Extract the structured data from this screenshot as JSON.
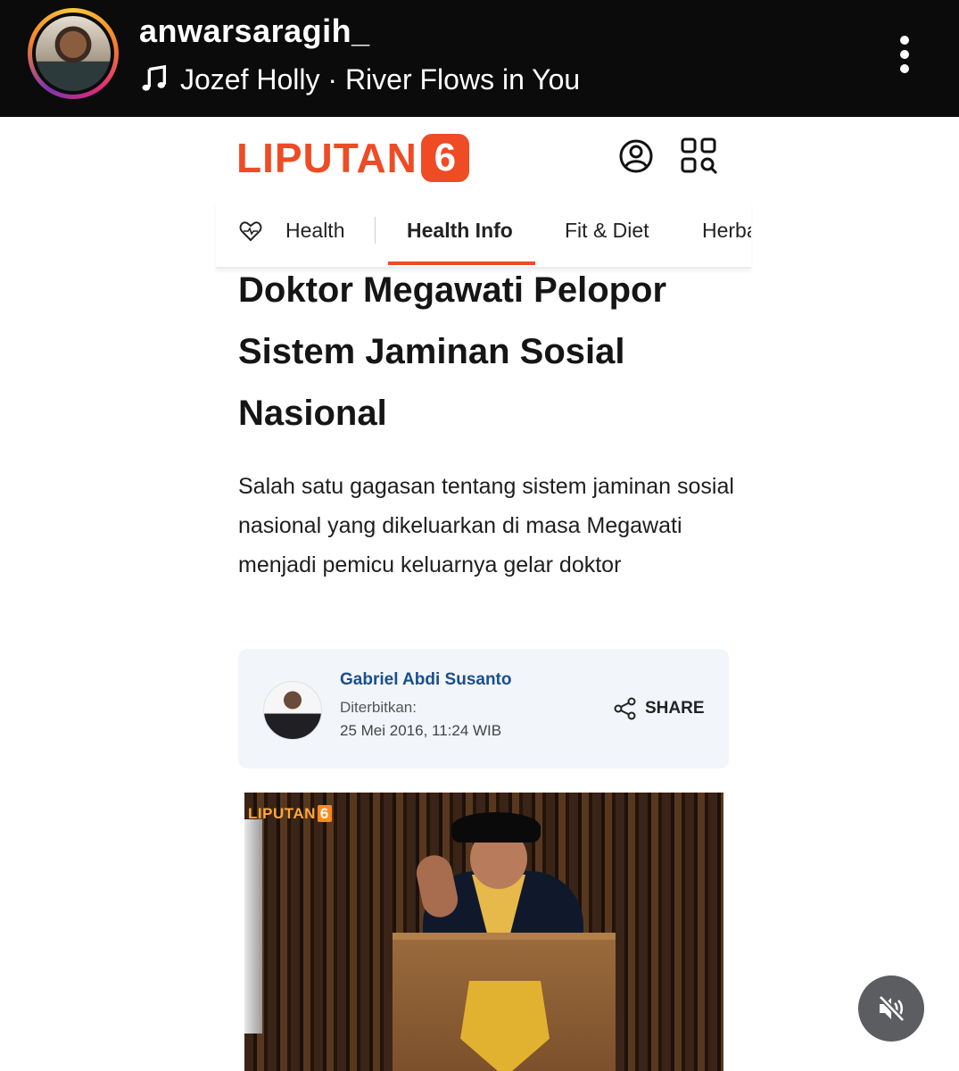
{
  "story": {
    "username": "anwarsaragih_",
    "music_label": "Jozef Holly · River Flows in You",
    "icons": {
      "music": "music-note-icon",
      "more": "more-vertical-icon",
      "mute": "mute-icon"
    }
  },
  "site": {
    "brand_text": "LIPUTAN",
    "brand_number": "6",
    "brand_color": "#ef4b25",
    "icons": {
      "account": "user-icon",
      "menu": "grid-search-icon",
      "category": "heart-pulse-icon",
      "share": "share-icon"
    },
    "tabs": [
      {
        "label": "Health",
        "active": false
      },
      {
        "label": "Health Info",
        "active": true
      },
      {
        "label": "Fit & Diet",
        "active": false
      },
      {
        "label": "Herba",
        "active": false
      }
    ]
  },
  "article": {
    "title": "Doktor Megawati Pelopor Sistem Jaminan Sosial Nasional",
    "summary": "Salah satu gagasan tentang sistem jaminan sosial nasional yang dikeluarkan di masa Megawati menjadi pemicu keluarnya gelar doktor",
    "author": {
      "name": "Gabriel Abdi Susanto",
      "published_label": "Diterbitkan:",
      "published_date": "25 Mei 2016, 11:24 WIB"
    },
    "share_label": "SHARE",
    "video_watermark": {
      "text": "LIPUTAN",
      "number": "6"
    }
  }
}
